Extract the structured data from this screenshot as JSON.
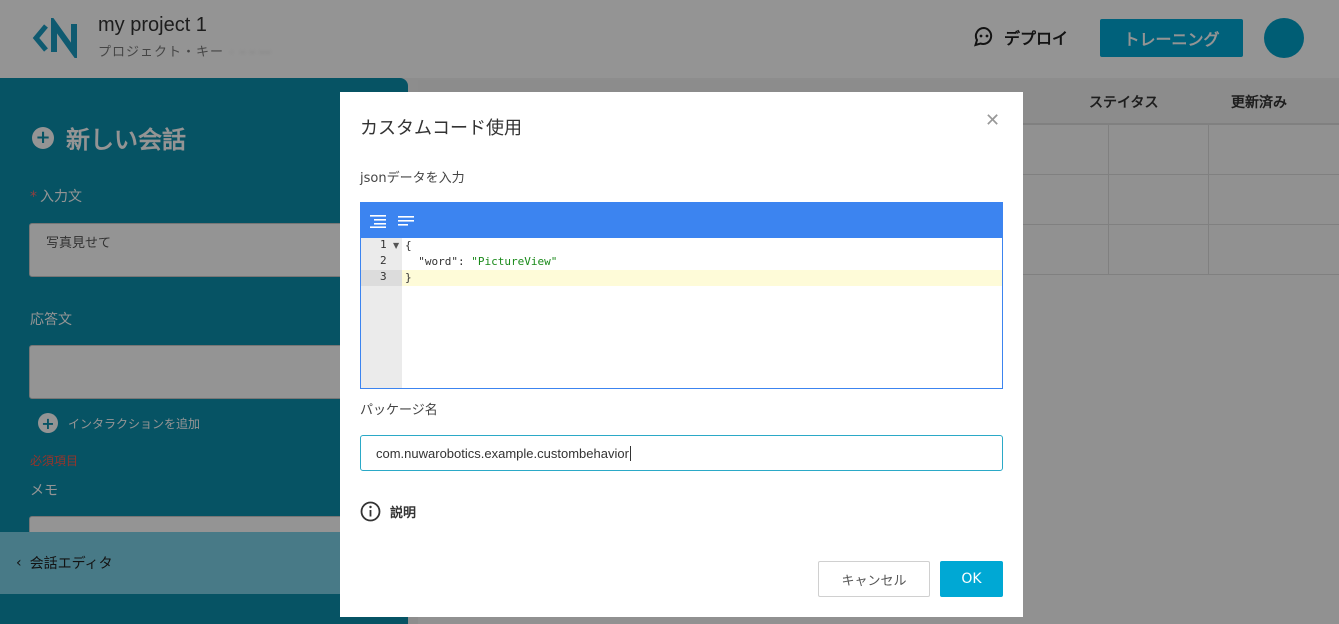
{
  "header": {
    "project_name": "my project 1",
    "project_key_label": "プロジェクト・キー",
    "project_key_value": "·  ·· ·· ····",
    "deploy_label": "デプロイ",
    "training_label": "トレーニング"
  },
  "left_panel": {
    "title": "新しい会話",
    "input_label": "入力文",
    "input_value": "写真見せて",
    "response_label": "応答文",
    "response_value": "",
    "add_interaction_label": "インタラクションを追加",
    "required_note": "必須項目",
    "memo_label": "メモ",
    "editor_link": "会話エディタ"
  },
  "table": {
    "columns": [
      "ステイタス",
      "更新済み"
    ]
  },
  "modal": {
    "title": "カスタムコード使用",
    "json_label": "jsonデータを入力",
    "code_lines": [
      {
        "num": "1",
        "text": "{"
      },
      {
        "num": "2",
        "key": "\"word\"",
        "sep": ": ",
        "value": "\"PictureView\""
      },
      {
        "num": "3",
        "text": "}"
      }
    ],
    "package_label": "パッケージ名",
    "package_value": "com.nuwarobotics.example.custombehavior",
    "explain_label": "説明",
    "cancel_label": "キャンセル",
    "ok_label": "OK"
  },
  "colors": {
    "accent": "#00a8d4",
    "panel": "#0b8fad",
    "editor_toolbar": "#3c84f0"
  }
}
